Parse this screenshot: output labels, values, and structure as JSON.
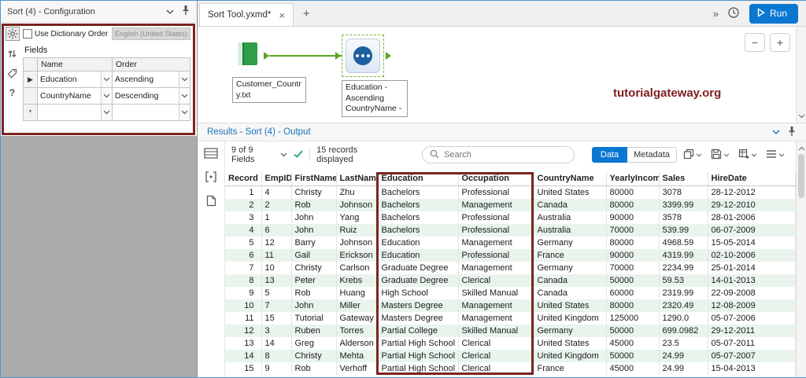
{
  "config_panel": {
    "title": "Sort (4) - Configuration",
    "use_dictionary_order": "Use Dictionary Order",
    "locale": "English (United States)",
    "fields_label": "Fields",
    "grid": {
      "name_header": "Name",
      "order_header": "Order",
      "rows": [
        {
          "selector": "▶",
          "name": "Education",
          "order": "Ascending"
        },
        {
          "selector": "",
          "name": "CountryName",
          "order": "Descending"
        },
        {
          "selector": "*",
          "name": "",
          "order": ""
        }
      ]
    }
  },
  "tab_bar": {
    "document_tab": "Sort Tool.yxmd*",
    "close_glyph": "×",
    "new_tab_glyph": "+",
    "overflow_glyph": "»",
    "run_label": "Run"
  },
  "canvas": {
    "input_tool_label": "Customer_Country.txt",
    "sort_tool_annotation": [
      "Education -",
      "Ascending",
      "CountryName -"
    ],
    "watermark": "tutorialgateway.org",
    "zoom_out_glyph": "−",
    "zoom_in_glyph": "+"
  },
  "results_panel": {
    "title": "Results - Sort (4) - Output",
    "fields_summary": "9 of 9 Fields",
    "records_summary": "15 records displayed",
    "search_placeholder": "Search",
    "data_button": "Data",
    "metadata_button": "Metadata",
    "table": {
      "columns": [
        "Record",
        "EmpID",
        "FirstName",
        "LastName",
        "Education",
        "Occupation",
        "CountryName",
        "YearlyIncome",
        "Sales",
        "HireDate"
      ],
      "rows": [
        [
          "1",
          "4",
          "Christy",
          "Zhu",
          "Bachelors",
          "Professional",
          "United States",
          "80000",
          "3078",
          "28-12-2012"
        ],
        [
          "2",
          "2",
          "Rob",
          "Johnson",
          "Bachelors",
          "Management",
          "Canada",
          "80000",
          "3399.99",
          "29-12-2010"
        ],
        [
          "3",
          "1",
          "John",
          "Yang",
          "Bachelors",
          "Professional",
          "Australia",
          "90000",
          "3578",
          "28-01-2006"
        ],
        [
          "4",
          "6",
          "John",
          "Ruiz",
          "Bachelors",
          "Professional",
          "Australia",
          "70000",
          "539.99",
          "06-07-2009"
        ],
        [
          "5",
          "12",
          "Barry",
          "Johnson",
          "Education",
          "Management",
          "Germany",
          "80000",
          "4968.59",
          "15-05-2014"
        ],
        [
          "6",
          "11",
          "Gail",
          "Erickson",
          "Education",
          "Professional",
          "France",
          "90000",
          "4319.99",
          "02-10-2006"
        ],
        [
          "7",
          "10",
          "Christy",
          "Carlson",
          "Graduate Degree",
          "Management",
          "Germany",
          "70000",
          "2234.99",
          "25-01-2014"
        ],
        [
          "8",
          "13",
          "Peter",
          "Krebs",
          "Graduate Degree",
          "Clerical",
          "Canada",
          "50000",
          "59.53",
          "14-01-2013"
        ],
        [
          "9",
          "5",
          "Rob",
          "Huang",
          "High School",
          "Skilled Manual",
          "Canada",
          "60000",
          "2319.99",
          "22-09-2008"
        ],
        [
          "10",
          "7",
          "John",
          "Miller",
          "Masters Degree",
          "Management",
          "United States",
          "80000",
          "2320.49",
          "12-08-2009"
        ],
        [
          "11",
          "15",
          "Tutorial",
          "Gateway",
          "Masters Degree",
          "Management",
          "United Kingdom",
          "125000",
          "1290.0",
          "05-07-2006"
        ],
        [
          "12",
          "3",
          "Ruben",
          "Torres",
          "Partial College",
          "Skilled Manual",
          "Germany",
          "50000",
          "699.0982",
          "29-12-2011"
        ],
        [
          "13",
          "14",
          "Greg",
          "Alderson",
          "Partial High School",
          "Clerical",
          "United States",
          "45000",
          "23.5",
          "05-07-2011"
        ],
        [
          "14",
          "8",
          "Christy",
          "Mehta",
          "Partial High School",
          "Clerical",
          "United Kingdom",
          "50000",
          "24.99",
          "05-07-2007"
        ],
        [
          "15",
          "9",
          "Rob",
          "Verhoff",
          "Partial High School",
          "Clerical",
          "France",
          "45000",
          "24.99",
          "15-04-2013"
        ]
      ]
    }
  },
  "colors": {
    "annotation_red": "#7c241e",
    "accent_blue": "#0a77d1",
    "canvas_green": "#5aa61e",
    "watermark_red": "#7e1f1f"
  }
}
